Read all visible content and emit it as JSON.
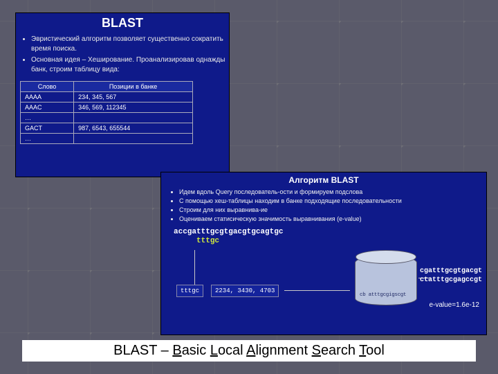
{
  "panel1": {
    "title": "BLAST",
    "bullets": [
      "Эвристический алгоритм позволяет существенно сократить время поиска.",
      "Основная идея – Хеширование. Проанализировав однажды банк, строим таблицу вида:"
    ],
    "table": {
      "headers": [
        "Слово",
        "Позиции в банке"
      ],
      "rows": [
        [
          "AAAA",
          "234, 345, 567"
        ],
        [
          "AAAC",
          "346, 569, 112345"
        ],
        [
          "…",
          ""
        ],
        [
          "GACT",
          "987, 6543, 655544"
        ],
        [
          "…",
          ""
        ]
      ]
    }
  },
  "panel2": {
    "title": "Алгоритм BLAST",
    "bullets": [
      "Идем вдоль Query последователь-ости и формируем подслова",
      "С помощью хеш-таблицы находим в банке подходящие последовательности",
      "Строим для них выравнива-ие",
      "Оцениваем статисическую значимость выравнивания (e-value)"
    ],
    "query_line1": "accgatttgcgtgacgtgcagtgc",
    "query_sub": "tttgc",
    "box_word": "tttgc",
    "box_positions": "2234, 3430, 4703",
    "cylinder_label": "cb atttgcgigscgt",
    "result1": "cgatttgcgtgacgt",
    "result2": "ctatttgcgagccgt",
    "evalue": "e-value=1.6e-12"
  },
  "caption": {
    "prefix": "BLAST – ",
    "b": "B",
    "basic": "asic ",
    "l": "L",
    "local": "ocal ",
    "a": "A",
    "align": "lignment ",
    "s": "S",
    "search": "earch ",
    "t": "T",
    "tool": "ool"
  }
}
